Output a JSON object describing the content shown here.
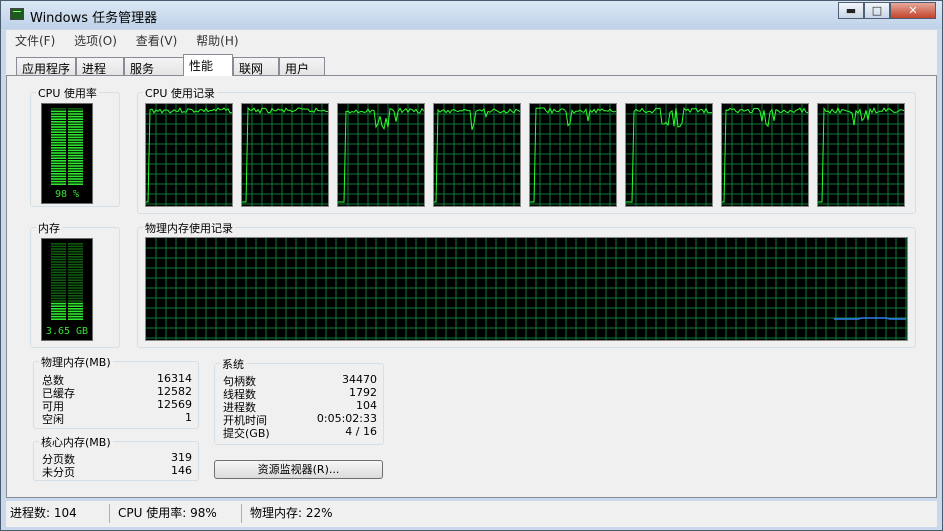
{
  "window": {
    "title": "Windows 任务管理器"
  },
  "caption_buttons": {
    "minimize": "▬",
    "maximize": "□",
    "close": "✕"
  },
  "menu": [
    "文件(F)",
    "选项(O)",
    "查看(V)",
    "帮助(H)"
  ],
  "tabs": [
    {
      "label": "应用程序",
      "active": false
    },
    {
      "label": "进程",
      "active": false
    },
    {
      "label": "服务",
      "active": false
    },
    {
      "label": "性能",
      "active": true
    },
    {
      "label": "联网",
      "active": false
    },
    {
      "label": "用户",
      "active": false
    }
  ],
  "cpu_usage": {
    "label": "CPU 使用率",
    "value_text": "98 %",
    "percent": 98
  },
  "cpu_history": {
    "label": "CPU 使用记录",
    "cores": 8
  },
  "memory": {
    "label": "内存",
    "value_text": "3.65 GB",
    "fraction": 0.22
  },
  "memory_history": {
    "label": "物理内存使用记录"
  },
  "physical_memory": {
    "label": "物理内存(MB)",
    "rows": [
      {
        "label": "总数",
        "value": "16314"
      },
      {
        "label": "已缓存",
        "value": "12582"
      },
      {
        "label": "可用",
        "value": "12569"
      },
      {
        "label": "空闲",
        "value": "1"
      }
    ]
  },
  "kernel_memory": {
    "label": "核心内存(MB)",
    "rows": [
      {
        "label": "分页数",
        "value": "319"
      },
      {
        "label": "未分页",
        "value": "146"
      }
    ]
  },
  "system": {
    "label": "系统",
    "rows": [
      {
        "label": "句柄数",
        "value": "34470"
      },
      {
        "label": "线程数",
        "value": "1792"
      },
      {
        "label": "进程数",
        "value": "104"
      },
      {
        "label": "开机时间",
        "value": "0:05:02:33"
      },
      {
        "label": "提交(GB)",
        "value": "4 / 16"
      }
    ]
  },
  "resource_monitor_button": "资源监视器(R)...",
  "status_bar": {
    "processes": "进程数: 104",
    "cpu": "CPU 使用率: 98%",
    "memory": "物理内存: 22%"
  },
  "colors": {
    "graph_line": "#2dff2d",
    "grid": "#0a7a3a",
    "memory_line": "#2f7ff0",
    "meter_on": "#2fe62f",
    "meter_off": "#0f5a0f"
  }
}
